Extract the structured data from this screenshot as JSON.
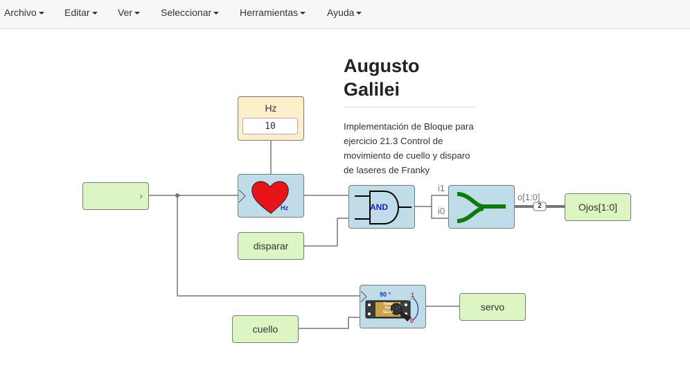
{
  "menu": {
    "items": [
      {
        "label": "Archivo"
      },
      {
        "label": "Editar"
      },
      {
        "label": "Ver"
      },
      {
        "label": "Seleccionar"
      },
      {
        "label": "Herramientas"
      },
      {
        "label": "Ayuda"
      }
    ]
  },
  "info": {
    "title_line1": "Augusto",
    "title_line2": "Galilei",
    "description": "Implementación de Bloque para ejercicio 21.3 Control de movimiento de cuello y disparo de laseres de Franky"
  },
  "blocks": {
    "input_port": {
      "label": ""
    },
    "constant": {
      "label": "Hz",
      "value": "10"
    },
    "heart": {
      "unit": "Hz"
    },
    "disparar": {
      "label": "disparar"
    },
    "and_gate": {
      "label": "AND"
    },
    "joiner": {
      "in1_label": "i1",
      "in0_label": "i0",
      "out_label": "o[1:0]",
      "bus_width": "2"
    },
    "ojos": {
      "label": "Ojos[1:0]"
    },
    "servo_block": {
      "angle": "90 °",
      "high": "1",
      "low": "0",
      "brand_line1": "Tower",
      "brand_line2": "Pro",
      "brand_line3": "SG-90"
    },
    "servo": {
      "label": "servo"
    },
    "cuello": {
      "label": "cuello"
    }
  },
  "colors": {
    "input_block": "#dcf5c2",
    "module_block": "#bfdce8",
    "constant_block": "#fcefc9",
    "wire": "#777777",
    "bus": "#777777",
    "heart": "#e8141c",
    "joiner_symbol": "#0e7a0e",
    "and_label": "#2020c0"
  }
}
